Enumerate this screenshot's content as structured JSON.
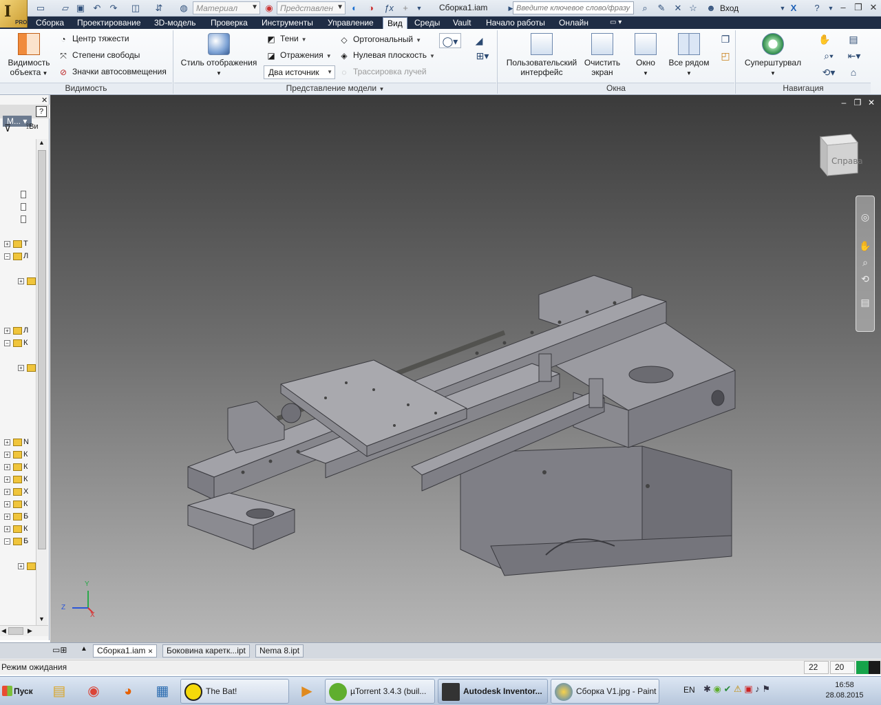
{
  "app": {
    "title": "Сборка1.iam",
    "logo_badge": "PRO",
    "search_placeholder": "Введите ключевое слово/фразу",
    "login": "Вход",
    "material_combo": "Материал",
    "appearance_combo": "Представлен"
  },
  "tabs": [
    "Сборка",
    "Проектирование",
    "3D-модель",
    "Проверка",
    "Инструменты",
    "Управление",
    "Вид",
    "Среды",
    "Vault",
    "Начало работы",
    "Онлайн"
  ],
  "active_tab": "Вид",
  "ribbon": {
    "visibility": {
      "big_label_1": "Видимость",
      "big_label_2": "объекта",
      "center_of_gravity": "Центр тяжести",
      "degrees_of_freedom": "Степени свободы",
      "auto_snap_icons": "Значки автосовмещения",
      "panel": "Видимость"
    },
    "model_view": {
      "display_style": "Стиль отображения",
      "shadows": "Тени",
      "reflections": "Отражения",
      "two_sources": "Два источник",
      "orthographic": "Ортогональный",
      "ground_plane": "Нулевая плоскость",
      "ray_tracing": "Трассировка лучей",
      "panel": "Представление модели"
    },
    "windows": {
      "user_interface_1": "Пользовательский",
      "user_interface_2": "интерфейс",
      "clean_screen_1": "Очистить",
      "clean_screen_2": "экран",
      "window": "Окно",
      "tile": "Все рядом",
      "panel": "Окна"
    },
    "navigation": {
      "steering_wheel": "Суперштурвал",
      "panel": "Навигация"
    }
  },
  "browser": {
    "selector": "М...",
    "filter_label": "Ви",
    "nodes": [
      "Т",
      "Л",
      "Л",
      "К",
      "N",
      "К",
      "К",
      "К",
      "Х",
      "К",
      "Б",
      "К",
      "Б"
    ]
  },
  "viewcube_label": "Справа",
  "axes": {
    "x": "X",
    "y": "Y",
    "z": "Z"
  },
  "doc_tabs": [
    "Сборка1.iam",
    "Боковина каретк...ipt",
    "Nema 8.ipt"
  ],
  "status": {
    "text": "Режим ожидания",
    "num1": "22",
    "num2": "20"
  },
  "taskbar": {
    "start": "Пуск",
    "tasks": [
      "The Bat!",
      "µTorrent 3.4.3  (buil...",
      "Autodesk Inventor...",
      "Сборка V1.jpg - Paint"
    ],
    "lang": "EN",
    "time": "16:58",
    "date": "28.08.2015"
  },
  "colors": {
    "tabbar": "#1f2d45",
    "viewport_top": "#3b3b3b",
    "viewport_bottom": "#b7b7b7",
    "model_grey": "#8f8f95"
  }
}
